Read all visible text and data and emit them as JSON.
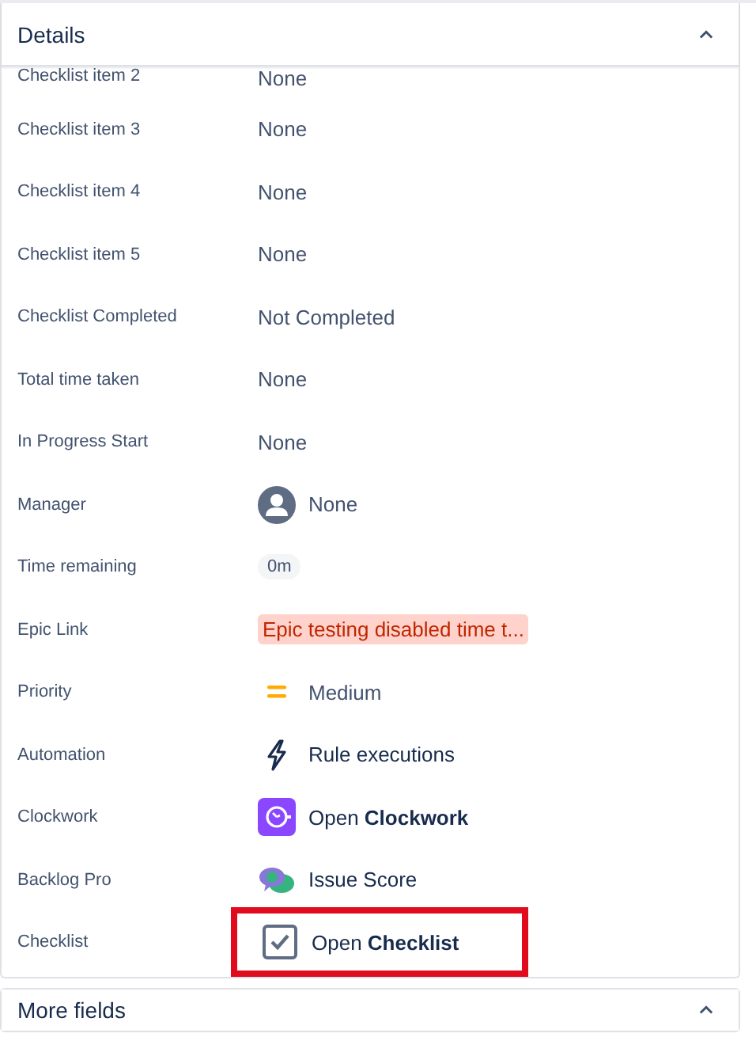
{
  "details": {
    "title": "Details",
    "expanded": true,
    "fields": [
      {
        "label": "Checklist item 2",
        "kind": "text",
        "value": "None"
      },
      {
        "label": "Checklist item 3",
        "kind": "text",
        "value": "None"
      },
      {
        "label": "Checklist item 4",
        "kind": "text",
        "value": "None"
      },
      {
        "label": "Checklist item 5",
        "kind": "text",
        "value": "None"
      },
      {
        "label": "Checklist Completed",
        "kind": "text",
        "value": "Not Completed"
      },
      {
        "label": "Total time taken",
        "kind": "text",
        "value": "None"
      },
      {
        "label": "In Progress Start",
        "kind": "text",
        "value": "None"
      },
      {
        "label": "Manager",
        "kind": "user",
        "value": "None"
      },
      {
        "label": "Time remaining",
        "kind": "chip",
        "value": "0m"
      },
      {
        "label": "Epic Link",
        "kind": "epic",
        "value": "Epic testing disabled time t..."
      },
      {
        "label": "Priority",
        "kind": "priority",
        "value": "Medium"
      },
      {
        "label": "Automation",
        "kind": "automation",
        "value": "Rule executions"
      },
      {
        "label": "Clockwork",
        "kind": "clockwork",
        "value": "Open **Clockwork**"
      },
      {
        "label": "Backlog Pro",
        "kind": "backlog",
        "value": "Issue Score"
      },
      {
        "label": "Checklist",
        "kind": "checklist",
        "value": "Open **Checklist**",
        "highlighted": true
      }
    ]
  },
  "more_fields": {
    "title": "More fields",
    "expanded": true
  }
}
